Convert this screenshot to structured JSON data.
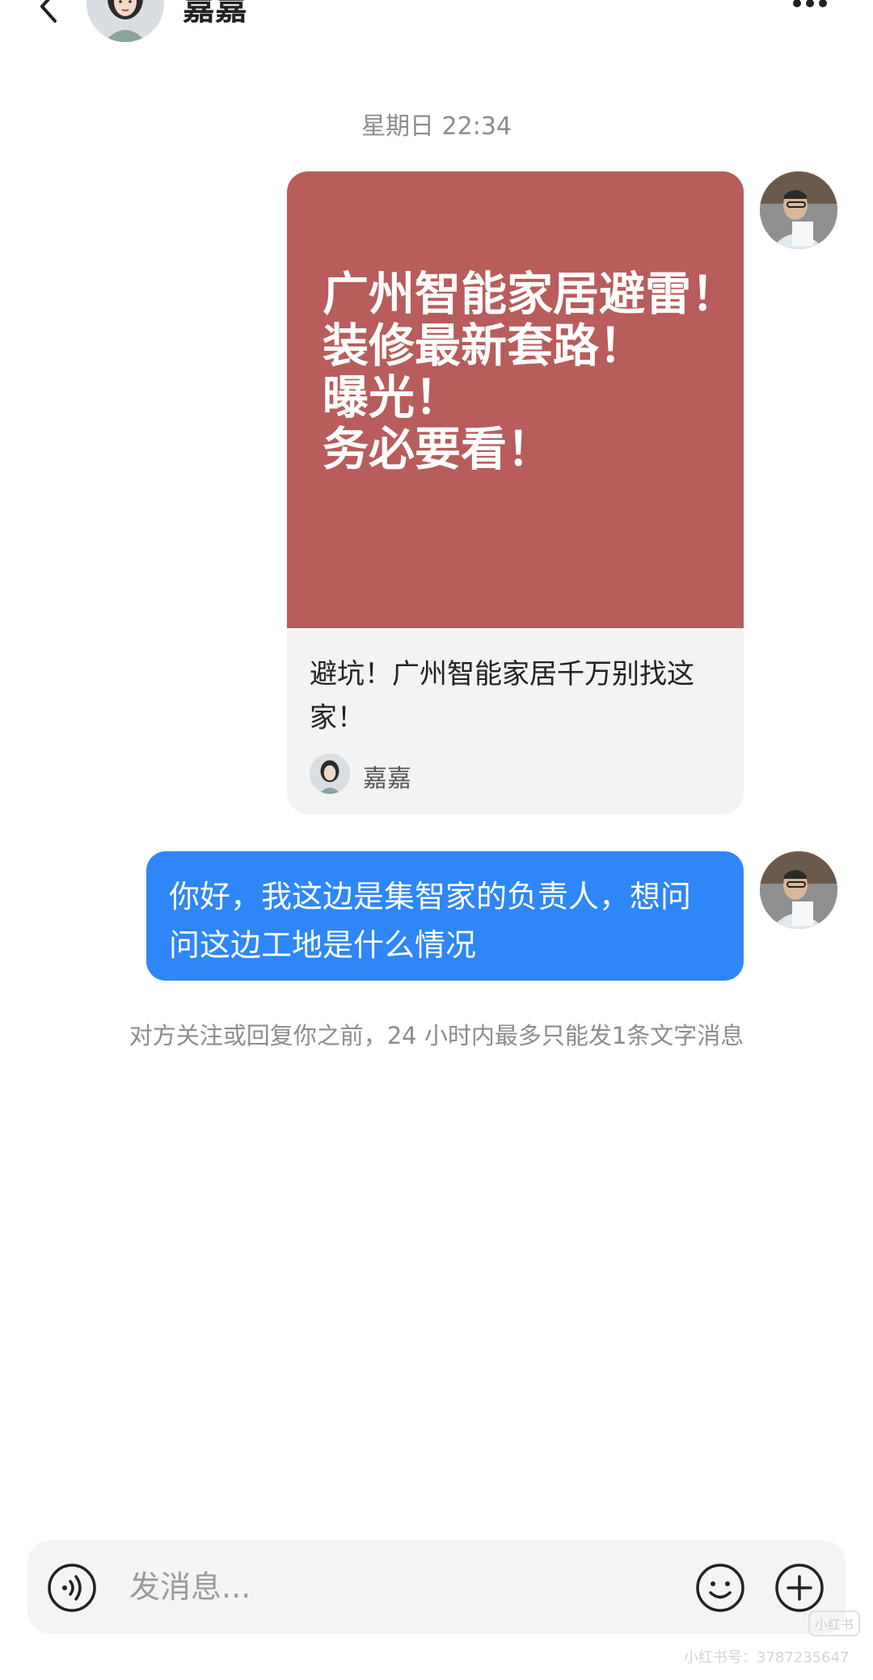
{
  "header": {
    "contact_name": "嘉嘉",
    "icons": {
      "back": "chevron-left-icon",
      "more": "ellipsis-icon"
    }
  },
  "chat": {
    "timestamp": "星期日 22:34",
    "shared_note": {
      "cover_lines": [
        "广州智能家居避雷！",
        "装修最新套路！",
        "曝光！",
        "务必要看！"
      ],
      "cover_color": "#b85c5c",
      "title": "避坑！广州智能家居千万别找这家！",
      "author": "嘉嘉"
    },
    "sent_message": "你好，我这边是集智家的负责人，想问问这边工地是什么情况",
    "bubble_color": "#2e86f8",
    "notice": "对方关注或回复你之前，24 小时内最多只能发1条文字消息"
  },
  "composer": {
    "placeholder": "发消息...",
    "icons": {
      "voice": "voice-icon",
      "emoji": "emoji-icon",
      "plus": "plus-icon"
    }
  },
  "watermark": {
    "logo": "小红书",
    "id_text": "小红书号：3787235647"
  }
}
